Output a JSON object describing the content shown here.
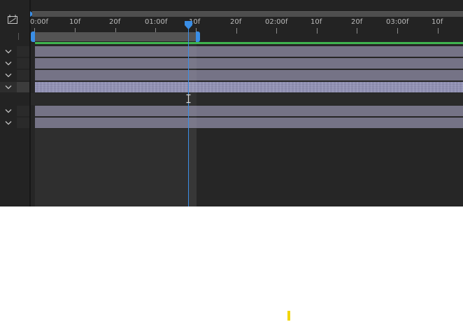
{
  "ruler": {
    "labels": [
      "0:00f",
      "10f",
      "20f",
      "01:00f",
      "10f",
      "20f",
      "02:00f",
      "10f",
      "20f",
      "03:00f",
      "10f"
    ]
  },
  "icons": {
    "composition": "comp-marker-icon",
    "twirl": "chevron-down-icon",
    "time_indicator": "playhead-icon",
    "cursor": "ibeam-cursor-icon"
  },
  "colors": {
    "panel_bg": "#232323",
    "layer_bar": "#757386",
    "selected_layer_bar": "#9696ba",
    "accent_blue": "#3a8ee6",
    "comp_duration_green": "#3fb34f",
    "marker_yellow": "#f2d60a"
  },
  "layers": [
    {
      "state": "normal"
    },
    {
      "state": "normal"
    },
    {
      "state": "normal"
    },
    {
      "state": "selected"
    },
    {
      "state": "empty"
    },
    {
      "state": "normal"
    },
    {
      "state": "normal"
    }
  ]
}
